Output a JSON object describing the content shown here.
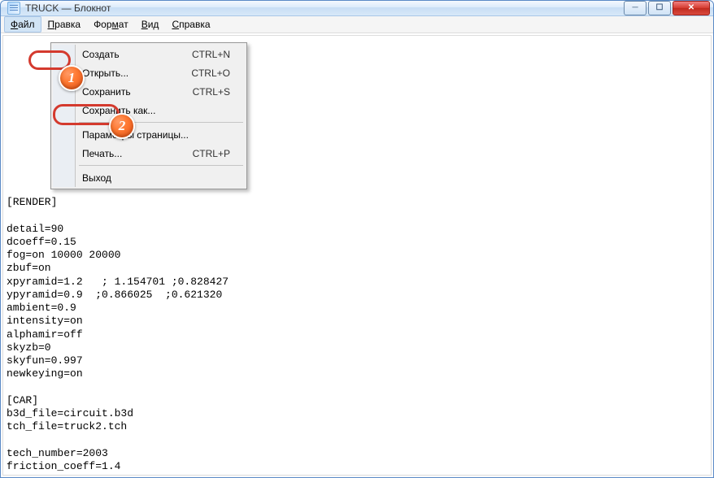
{
  "window": {
    "title": "TRUCK — Блокнот"
  },
  "menubar": {
    "file": "Файл",
    "edit": "Правка",
    "format": "Формат",
    "view": "Вид",
    "help": "Справка"
  },
  "dropdown": {
    "create": "Создать",
    "create_sc": "CTRL+N",
    "open": "Открыть...",
    "open_sc": "CTRL+O",
    "save": "Сохранить",
    "save_sc": "CTRL+S",
    "save_as": "Сохранить как...",
    "page_setup": "Параметры страницы...",
    "print": "Печать...",
    "print_sc": "CTRL+P",
    "exit": "Выход"
  },
  "callouts": {
    "one": "1",
    "two": "2"
  },
  "text_content": "\n\n\n\n\n\n\n\n\n\n\n\n[RENDER]\n\ndetail=90\ndcoeff=0.15\nfog=on 10000 20000\nzbuf=on\nxpyramid=1.2   ; 1.154701 ;0.828427\nypyramid=0.9  ;0.866025  ;0.621320\nambient=0.9\nintensity=on\nalphamir=off\nskyzb=0\nskyfun=0.997\nnewkeying=on\n\n[CAR]\nb3d_file=circuit.b3d\ntch_file=truck2.tch\n\ntech_number=2003\nfriction_coeff=1.4"
}
